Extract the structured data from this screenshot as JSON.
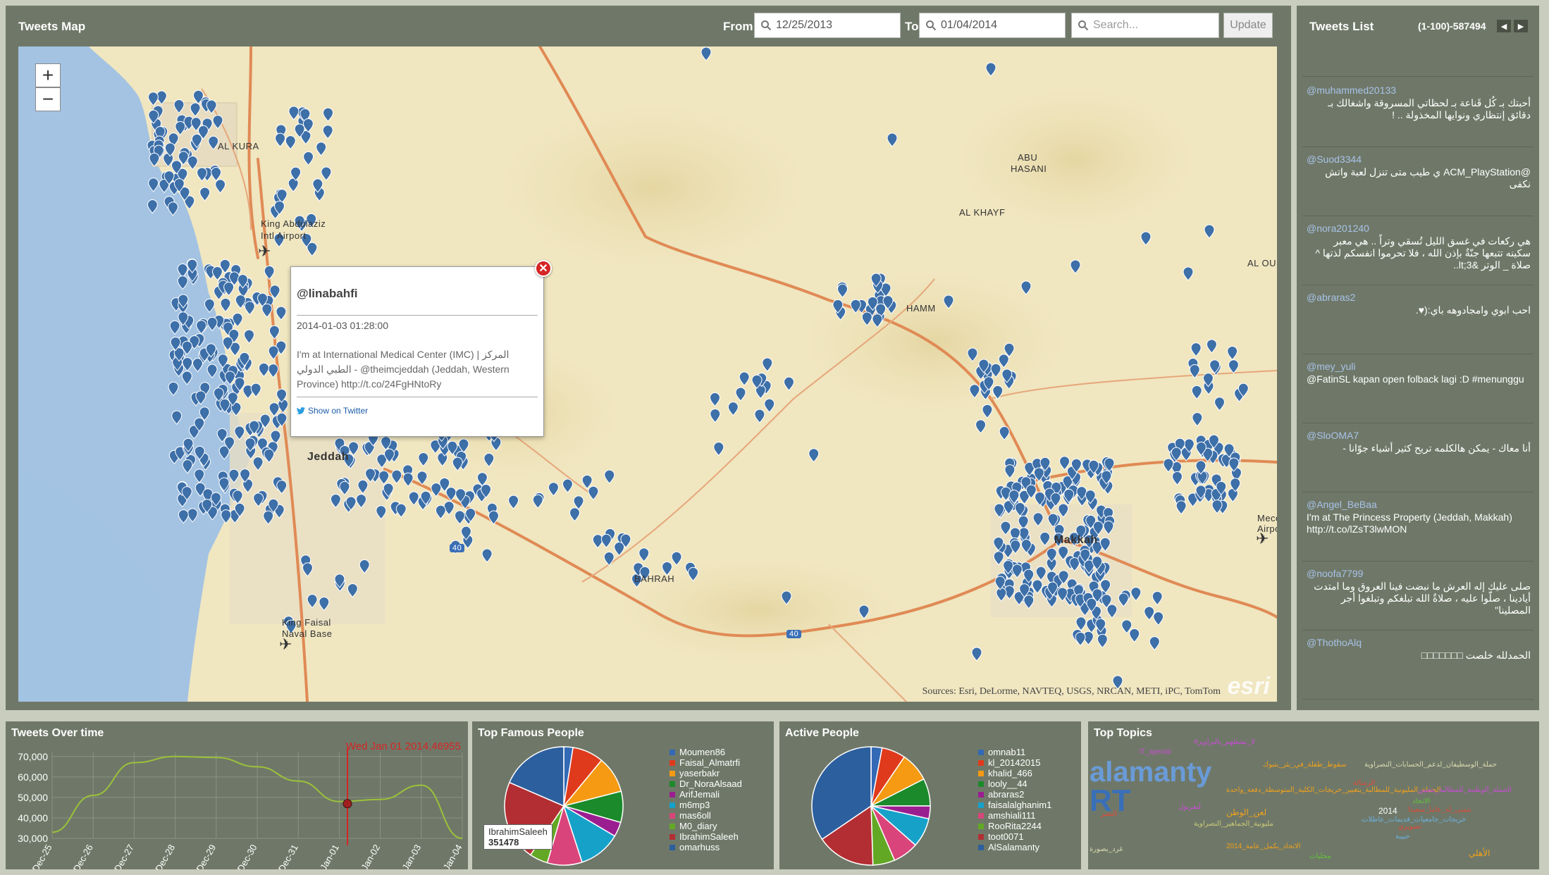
{
  "map": {
    "title": "Tweets Map",
    "from_label": "From",
    "from_value": "12/25/2013",
    "to_label": "To",
    "to_value": "01/04/2014",
    "search_placeholder": "Search...",
    "update_label": "Update",
    "zoom_in": "+",
    "zoom_out": "−",
    "attribution": "Sources: Esri, DeLorme, NAVTEQ, USGS, NRCAN, METI, iPC, TomTom",
    "logo": "esri",
    "places": [
      "AL KURA",
      "King Abdulaziz",
      "Intl Airport",
      "ABU",
      "HASANI",
      "AL KHAYF",
      "HAMM",
      "BAHRAH",
      "King Faisal",
      "Naval Base",
      "Meco",
      "Airpo",
      "AL OU",
      "Jeddah",
      "Makkah",
      "40",
      "40"
    ]
  },
  "popup": {
    "user": "@linabahfi",
    "time": "2014-01-03 01:28:00",
    "text": "I'm at International Medical Center (IMC) | المركز الطبي الدولي - @theimcjeddah (Jeddah, Western Province) http://t.co/24FgHNtoRy",
    "link": "Show on Twitter"
  },
  "list": {
    "title": "Tweets List",
    "count": "(1-100)-587494",
    "tweets": [
      {
        "user": "@muhammed20133",
        "text": "أحبتك بـ كُل قَناعة بـ لحظاتي المسروقة واشغالك بـ دقائق إنتظاري ونوايها المخذولة .. !",
        "rtl": true
      },
      {
        "user": "@Suod3344",
        "text": "@ACM_PlayStation ي طيب متى تنزل لعبة واتش نكفى",
        "rtl": true
      },
      {
        "user": "@nora201240",
        "text": "هي ركعات في غسق الليل تُسقي وتراً .. هي معبر سكينه تتبعها جنّةٌ بإذن الله ، فلا تحرموا انفسكم لذتها ^ صلاة _ الوتر &lt;3..",
        "rtl": true
      },
      {
        "user": "@abraras2",
        "text": "احب ابوي وامجادوهه باي:(♥.",
        "rtl": true
      },
      {
        "user": "@mey_yuli",
        "text": "@FatinSL kapan open folback lagi :D #menunggu",
        "rtl": false
      },
      {
        "user": "@SloOMA7",
        "text": "أنا معاك - يمكن هالكلمه تريح كثير أشياء جوّانا -",
        "rtl": true
      },
      {
        "user": "@Angel_BeBaa",
        "text": "I'm at The Princess Property (Jeddah, Makkah) http://t.co/lZsT3lwMON",
        "rtl": false
      },
      {
        "user": "@noofa7799",
        "text": "صلى عليك إله العرش ما نبضت فينا العروق وما امتدت أيادينا ، صلّوا عليه ، صلاةٌ الله تبلغكم وتبلغوا أجر المصلينا\"",
        "rtl": true
      },
      {
        "user": "@ThothoAlq",
        "text": "الحمدلله خلصت □□□□□□□",
        "rtl": true
      }
    ]
  },
  "colors": {
    "panel": "#6f7868",
    "page": "#c9cdbd",
    "pin": "#3d6fa8",
    "road": "#e08a55",
    "water": "#a4c3e2",
    "land": "#f0e6c0"
  },
  "time_chart": {
    "title": "Tweets Over time",
    "marker_label": "Wed Jan 01 2014,46955"
  },
  "chart_data": [
    {
      "type": "line",
      "title": "Tweets Over time",
      "x": [
        "Dec-25",
        "Dec-26",
        "Dec-27",
        "Dec-28",
        "Dec-29",
        "Dec-30",
        "Dec-31",
        "Jan-01",
        "Jan-02",
        "Jan-03",
        "Jan-04"
      ],
      "series": [
        {
          "values": [
            33000,
            51000,
            67000,
            70000,
            69500,
            65000,
            58000,
            48000,
            49000,
            56000,
            30000
          ]
        }
      ],
      "yticks": [
        30000,
        40000,
        50000,
        60000,
        70000
      ],
      "ylim": [
        30000,
        72000
      ],
      "color": "#9bc13a",
      "marker": {
        "x": "Jan-01",
        "y": 46955,
        "label": "Wed Jan 01 2014,46955"
      },
      "xlabel": "",
      "ylabel": "",
      "grid": true
    },
    {
      "type": "pie",
      "title": "Top Famous People",
      "series": [
        {
          "name": "Moumen86",
          "value": 0.025,
          "color": "#3369b5"
        },
        {
          "name": "Faisal_Almatrfi",
          "value": 0.085,
          "color": "#e03a1c"
        },
        {
          "name": "yaserbakr",
          "value": 0.1,
          "color": "#f59a12"
        },
        {
          "name": "Dr_NoraAlsaad",
          "value": 0.085,
          "color": "#1b8a2a"
        },
        {
          "name": "ArifJemali",
          "value": 0.04,
          "color": "#9b1e91"
        },
        {
          "name": "m6mp3",
          "value": 0.115,
          "color": "#16a1c9"
        },
        {
          "name": "mas6oll",
          "value": 0.095,
          "color": "#d9457a"
        },
        {
          "name": "M0_diary",
          "value": 0.05,
          "color": "#63a824"
        },
        {
          "name": "IbrahimSaleeh",
          "value": 0.22,
          "color": "#b32e33"
        },
        {
          "name": "omarhuss",
          "value": 0.185,
          "color": "#2c5f9e"
        }
      ],
      "tooltip": {
        "name": "IbrahimSaleeh",
        "value": "351478"
      }
    },
    {
      "type": "pie",
      "title": "Active People",
      "series": [
        {
          "name": "omnab11",
          "value": 0.03,
          "color": "#3369b5"
        },
        {
          "name": "kl_20142015",
          "value": 0.065,
          "color": "#e03a1c"
        },
        {
          "name": "khalid_466",
          "value": 0.08,
          "color": "#f59a12"
        },
        {
          "name": "looly__44",
          "value": 0.075,
          "color": "#1b8a2a"
        },
        {
          "name": "abraras2",
          "value": 0.035,
          "color": "#9b1e91"
        },
        {
          "name": "faisalalghanim1",
          "value": 0.08,
          "color": "#16a1c9"
        },
        {
          "name": "amshiali111",
          "value": 0.07,
          "color": "#d9457a"
        },
        {
          "name": "RooRita2244",
          "value": 0.06,
          "color": "#63a824"
        },
        {
          "name": "toot0071",
          "value": 0.16,
          "color": "#b32e33"
        },
        {
          "name": "AlSalamanty",
          "value": 0.345,
          "color": "#2c5f9e"
        }
      ]
    }
  ],
  "famous": {
    "title": "Top Famous People"
  },
  "active": {
    "title": "Active People"
  },
  "topics": {
    "title": "Top Topics",
    "words": [
      {
        "text": "alamanty",
        "color": "#6a9bd8",
        "size": 40
      },
      {
        "text": "RT",
        "color": "#3a6fb8",
        "size": 44
      },
      {
        "text": "#لا_تشغلهم_بالبراويز",
        "color": "#c94bd6",
        "size": 10
      },
      {
        "text": "IT_special",
        "color": "#c94bd6",
        "size": 10
      },
      {
        "text": "سقوط_طفلة_في_بئر_بتبوك",
        "color": "#f0a01c",
        "size": 10
      },
      {
        "text": "حملة_الوسطيفان_لدعم_الحسابات_النصراوية",
        "color": "#d9d9b0",
        "size": 10
      },
      {
        "text": "الحملة_المليونية_للمطالبة_بتغيير_خريجات_الكلية_المتوسطة_دفعة_واحدة",
        "color": "#f0a01c",
        "size": 10
      },
      {
        "text": "الرسالة",
        "color": "#e04a3a",
        "size": 10
      },
      {
        "text": "الحملة_الوطنية_للمطالبة_بتعيين",
        "color": "#c94bd6",
        "size": 10
      },
      {
        "text": "الاتحاد",
        "color": "#63c43a",
        "size": 10
      },
      {
        "text": "2014",
        "color": "#ffffff",
        "size": 12
      },
      {
        "text": "نتمنى_له_عاما_سعيدا",
        "color": "#e04a3a",
        "size": 10
      },
      {
        "text": "النصر",
        "color": "#e04a3a",
        "size": 10
      },
      {
        "text": "ليفربول",
        "color": "#c94bd6",
        "size": 10
      },
      {
        "text": "لعن_الوطن",
        "color": "#f0a01c",
        "size": 12
      },
      {
        "text": "خريجات_جامعيات_قديمات_عاطلات",
        "color": "#6ab0e0",
        "size": 10
      },
      {
        "text": "مليونية_الجماهير_النصراوية",
        "color": "#c9c977",
        "size": 10
      },
      {
        "text": "تصويري",
        "color": "#e04a3a",
        "size": 10
      },
      {
        "text": "الاتحاد_يكمل_عامة_2014",
        "color": "#f0a01c",
        "size": 10
      },
      {
        "text": "حبيبة",
        "color": "#6ab0e0",
        "size": 10
      },
      {
        "text": "غرد_بصورة",
        "color": "#d9d9b0",
        "size": 10
      },
      {
        "text": "محليات",
        "color": "#63c43a",
        "size": 10
      },
      {
        "text": "الأهلي",
        "color": "#f0a01c",
        "size": 12
      }
    ]
  }
}
